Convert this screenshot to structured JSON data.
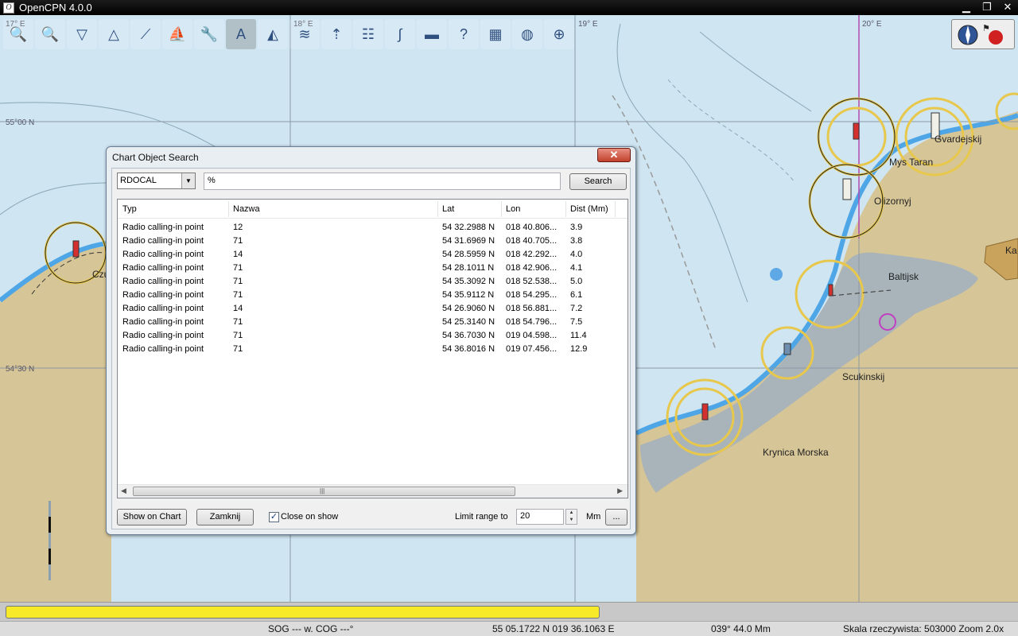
{
  "window": {
    "title": "OpenCPN 4.0.0",
    "controls": [
      "▁",
      "❐",
      "✕"
    ]
  },
  "toolbar": {
    "tools": [
      {
        "name": "zoom-in-icon",
        "glyph": "🔍"
      },
      {
        "name": "zoom-out-icon",
        "glyph": "🔍"
      },
      {
        "name": "scale-in-icon",
        "glyph": "▽"
      },
      {
        "name": "scale-out-icon",
        "glyph": "△"
      },
      {
        "name": "route-icon",
        "glyph": "⟋"
      },
      {
        "name": "follow-ship-icon",
        "glyph": "⛵"
      },
      {
        "name": "settings-icon",
        "glyph": "🔧"
      },
      {
        "name": "text-icon",
        "glyph": "A"
      },
      {
        "name": "ais-icon",
        "glyph": "◭"
      },
      {
        "name": "current-icon",
        "glyph": "≋"
      },
      {
        "name": "tide-icon",
        "glyph": "⇡"
      },
      {
        "name": "route-manager-icon",
        "glyph": "☷"
      },
      {
        "name": "track-icon",
        "glyph": "∫"
      },
      {
        "name": "color-scheme-icon",
        "glyph": "▬"
      },
      {
        "name": "help-icon",
        "glyph": "?"
      },
      {
        "name": "chart-quilt-icon",
        "glyph": "▦"
      },
      {
        "name": "mob-icon",
        "glyph": "◍"
      },
      {
        "name": "search-chart-icon",
        "glyph": "⊕"
      }
    ]
  },
  "map": {
    "grid_labels": {
      "lon_17": "17° E",
      "lon_18": "18° E",
      "lon_19": "19° E",
      "lon_20": "20° E",
      "lat_55": "55°00 N",
      "lat_54_30": "54°30 N"
    },
    "place_labels": [
      "Czu",
      "Gvardejskij",
      "Mys Taran",
      "Olizornyj",
      "Baltijsk",
      "Ka",
      "Scukinskij",
      "Krynica Morska"
    ]
  },
  "dialog": {
    "title": "Chart Object Search",
    "close_glyph": "✕",
    "object_type": "RDOCAL",
    "query": "%",
    "search_label": "Search",
    "columns": [
      "Typ",
      "Nazwa",
      "Lat",
      "Lon",
      "Dist (Mm)"
    ],
    "rows": [
      [
        "Radio calling-in point",
        "12",
        "54 32.2988 N",
        "018 40.806...",
        "3.9"
      ],
      [
        "Radio calling-in point",
        "71",
        "54 31.6969 N",
        "018 40.705...",
        "3.8"
      ],
      [
        "Radio calling-in point",
        "14",
        "54 28.5959 N",
        "018 42.292...",
        "4.0"
      ],
      [
        "Radio calling-in point",
        "71",
        "54 28.1011 N",
        "018 42.906...",
        "4.1"
      ],
      [
        "Radio calling-in point",
        "71",
        "54 35.3092 N",
        "018 52.538...",
        "5.0"
      ],
      [
        "Radio calling-in point",
        "71",
        "54 35.9112 N",
        "018 54.295...",
        "6.1"
      ],
      [
        "Radio calling-in point",
        "14",
        "54 26.9060 N",
        "018 56.881...",
        "7.2"
      ],
      [
        "Radio calling-in point",
        "71",
        "54 25.3140 N",
        "018 54.796...",
        "7.5"
      ],
      [
        "Radio calling-in point",
        "71",
        "54 36.7030 N",
        "019 04.598...",
        "11.4"
      ],
      [
        "Radio calling-in point",
        "71",
        "54 36.8016 N",
        "019 07.456...",
        "12.9"
      ]
    ],
    "show_on_chart_label": "Show on Chart",
    "close_label": "Zamknij",
    "close_on_show_checked": "✓",
    "close_on_show_label": "Close on show",
    "limit_range_label": "Limit range to",
    "limit_range_value": "20",
    "unit": "Mm",
    "more_label": "...",
    "spin_up": "▲",
    "spin_down": "▼",
    "scroll_left": "◀",
    "scroll_right": "▶",
    "scroll_grip": "|||"
  },
  "progress": {
    "fraction": 0.59
  },
  "status": {
    "sog_cog": "SOG --- w. COG ---°",
    "position": "55 05.1722 N   019 36.1063 E",
    "bearing_dist": "039°  44.0 Mm",
    "scale": "Skala rzeczywista:    503000  Zoom  2.0x"
  }
}
